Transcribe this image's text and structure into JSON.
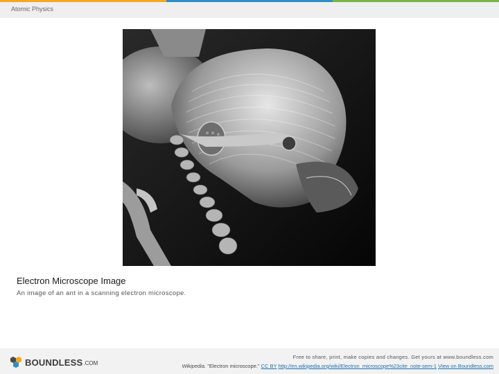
{
  "header": {
    "course": "Atomic Physics"
  },
  "figure": {
    "icon": "ant-sem-image"
  },
  "caption": {
    "title": "Electron Microscope Image",
    "text": "An image of an ant in a scanning electron microscope."
  },
  "footer": {
    "brand": "BOUNDLESS",
    "brand_suffix": ".COM",
    "free_text": "Free to share, print, make copies and changes. Get yours at www.boundless.com",
    "source_name": "Wikipedia.",
    "source_title": " \"Electron microscope.\" ",
    "license": "CC BY",
    "url": "http://en.wikipedia.org/wiki/Electron_microscope%23cite_note-sem-1",
    "view_link": "View on Boundless.com"
  }
}
